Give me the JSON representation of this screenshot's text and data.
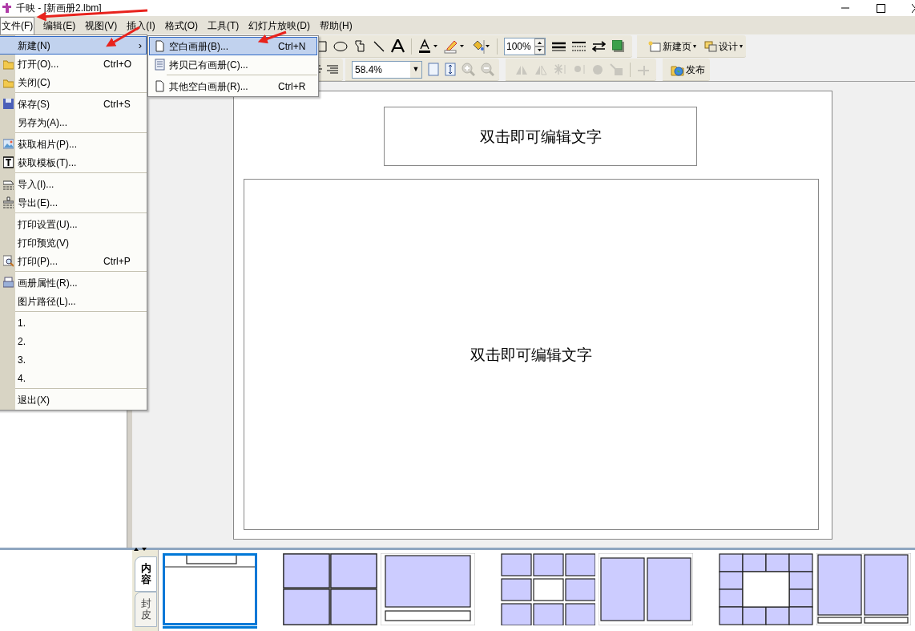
{
  "window": {
    "title": "千映 - [新画册2.lbm]"
  },
  "menubar": [
    {
      "label": "文件(F)",
      "selected": true
    },
    {
      "label": "编辑(E)",
      "selected": false
    },
    {
      "label": "视图(V)",
      "selected": false
    },
    {
      "label": "插入(I)",
      "selected": false
    },
    {
      "label": "格式(O)",
      "selected": false
    },
    {
      "label": "工具(T)",
      "selected": false
    },
    {
      "label": "幻灯片放映(D)",
      "selected": false
    },
    {
      "label": "帮助(H)",
      "selected": false
    }
  ],
  "file_menu": {
    "groups": [
      [
        {
          "label": "新建(N)",
          "submenu_arrow": "›",
          "highlighted": true
        },
        {
          "label": "打开(O)...",
          "shortcut": "Ctrl+O",
          "highlighted": false
        },
        {
          "label": "关闭(C)",
          "highlighted": false
        }
      ],
      [
        {
          "label": "保存(S)",
          "shortcut": "Ctrl+S",
          "highlighted": false
        },
        {
          "label": "另存为(A)...",
          "highlighted": false
        }
      ],
      [
        {
          "label": "获取相片(P)...",
          "highlighted": false
        },
        {
          "label": "获取模板(T)...",
          "highlighted": false
        }
      ],
      [
        {
          "label": "导入(I)...",
          "highlighted": false
        },
        {
          "label": "导出(E)...",
          "highlighted": false
        }
      ],
      [
        {
          "label": "打印设置(U)...",
          "highlighted": false
        },
        {
          "label": "打印预览(V)",
          "highlighted": false
        },
        {
          "label": "打印(P)...",
          "shortcut": "Ctrl+P",
          "highlighted": false
        }
      ],
      [
        {
          "label": "画册属性(R)...",
          "highlighted": false
        },
        {
          "label": "图片路径(L)...",
          "highlighted": false
        }
      ],
      [
        {
          "label": "1.",
          "highlighted": false
        },
        {
          "label": "2.",
          "highlighted": false
        },
        {
          "label": "3.",
          "highlighted": false
        },
        {
          "label": "4.",
          "highlighted": false
        }
      ],
      [
        {
          "label": "退出(X)",
          "highlighted": false
        }
      ]
    ]
  },
  "new_submenu": {
    "groups": [
      [
        {
          "label": "空白画册(B)...",
          "shortcut": "Ctrl+N",
          "highlighted": true
        },
        {
          "label": "拷贝已有画册(C)...",
          "highlighted": false
        }
      ],
      [
        {
          "label": "其他空白画册(R)...",
          "shortcut": "Ctrl+R",
          "highlighted": false
        }
      ]
    ]
  },
  "toolbar": {
    "line_zoom": "100%",
    "new_page": "新建页",
    "new_page_caret": "▾",
    "design": "设计",
    "design_caret": "▾",
    "view_zoom": "58.4%",
    "zoom_caret": "▼",
    "publish": "发布"
  },
  "page": {
    "title_box": "双击即可编辑文字",
    "content_box": "双击即可编辑文字"
  },
  "side_tabs": [
    {
      "label": "内容",
      "selected": true
    },
    {
      "label": "封皮",
      "selected": false
    }
  ],
  "layouts": [
    {
      "kind": "title",
      "selected": true
    },
    {
      "kind": "grid4",
      "selected": false
    },
    {
      "kind": "photo_caption",
      "selected": false
    },
    {
      "kind": "grid9",
      "selected": false
    },
    {
      "kind": "two_columns",
      "selected": false
    },
    {
      "kind": "ring",
      "selected": false
    },
    {
      "kind": "two_columns_captions",
      "selected": false
    }
  ]
}
